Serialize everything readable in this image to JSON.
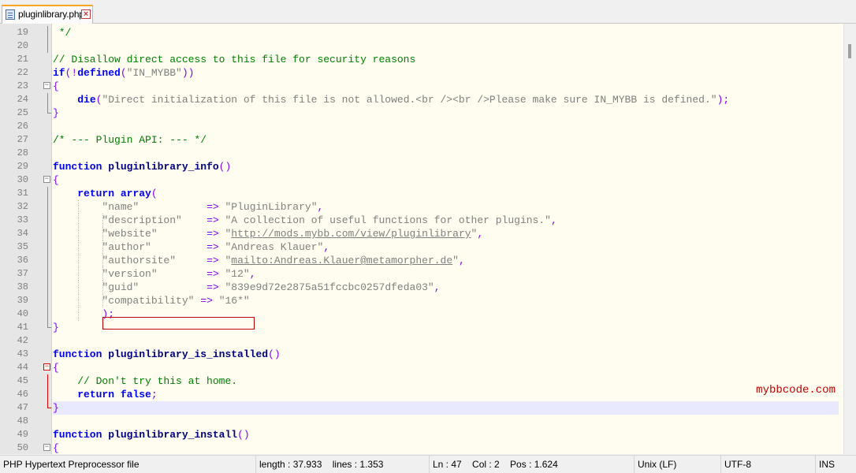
{
  "tab": {
    "filename": "pluginlibrary.php",
    "icon": "php-file-icon",
    "close_icon": "close-icon"
  },
  "lines": [
    {
      "n": "19",
      "fold": "vline",
      "tokens": [
        [
          "cmt",
          " */"
        ]
      ]
    },
    {
      "n": "20",
      "fold": "vline",
      "tokens": []
    },
    {
      "n": "21",
      "fold": "",
      "tokens": [
        [
          "cmt",
          "// Disallow direct access to this file for security reasons"
        ]
      ]
    },
    {
      "n": "22",
      "fold": "",
      "tokens": [
        [
          "kw",
          "if"
        ],
        [
          "op",
          "(!"
        ],
        [
          "kw",
          "defined"
        ],
        [
          "op",
          "("
        ],
        [
          "str",
          "\"IN_MYBB\""
        ],
        [
          "op",
          "))"
        ]
      ]
    },
    {
      "n": "23",
      "fold": "box",
      "tokens": [
        [
          "op",
          "{"
        ]
      ]
    },
    {
      "n": "24",
      "fold": "vline",
      "tokens": [
        [
          "plain",
          "    "
        ],
        [
          "kw",
          "die"
        ],
        [
          "op",
          "("
        ],
        [
          "str",
          "\"Direct initialization of this file is not allowed.<br /><br />Please make sure IN_MYBB is defined.\""
        ],
        [
          "op",
          ");"
        ]
      ]
    },
    {
      "n": "25",
      "fold": "end",
      "tokens": [
        [
          "op",
          "}"
        ]
      ]
    },
    {
      "n": "26",
      "fold": "",
      "tokens": []
    },
    {
      "n": "27",
      "fold": "",
      "tokens": [
        [
          "cmt",
          "/* --- Plugin API: --- */"
        ]
      ]
    },
    {
      "n": "28",
      "fold": "",
      "tokens": []
    },
    {
      "n": "29",
      "fold": "",
      "tokens": [
        [
          "kw",
          "function"
        ],
        [
          "plain",
          " "
        ],
        [
          "fn",
          "pluginlibrary_info"
        ],
        [
          "op",
          "()"
        ]
      ]
    },
    {
      "n": "30",
      "fold": "box",
      "tokens": [
        [
          "op",
          "{"
        ]
      ]
    },
    {
      "n": "31",
      "fold": "vline",
      "tokens": [
        [
          "plain",
          "    "
        ],
        [
          "kw",
          "return"
        ],
        [
          "plain",
          " "
        ],
        [
          "kw",
          "array"
        ],
        [
          "op",
          "("
        ]
      ]
    },
    {
      "n": "32",
      "fold": "vline",
      "tokens": [
        [
          "plain",
          "        "
        ],
        [
          "str",
          "\"name\""
        ],
        [
          "plain",
          "           "
        ],
        [
          "op",
          "=>"
        ],
        [
          "plain",
          " "
        ],
        [
          "str",
          "\"PluginLibrary\""
        ],
        [
          "op",
          ","
        ]
      ]
    },
    {
      "n": "33",
      "fold": "vline",
      "tokens": [
        [
          "plain",
          "        "
        ],
        [
          "str",
          "\"description\""
        ],
        [
          "plain",
          "    "
        ],
        [
          "op",
          "=>"
        ],
        [
          "plain",
          " "
        ],
        [
          "str",
          "\"A collection of useful functions for other plugins.\""
        ],
        [
          "op",
          ","
        ]
      ]
    },
    {
      "n": "34",
      "fold": "vline",
      "tokens": [
        [
          "plain",
          "        "
        ],
        [
          "str",
          "\"website\""
        ],
        [
          "plain",
          "        "
        ],
        [
          "op",
          "=>"
        ],
        [
          "plain",
          " "
        ],
        [
          "str",
          "\""
        ],
        [
          "url",
          "http://mods.mybb.com/view/pluginlibrary"
        ],
        [
          "str",
          "\""
        ],
        [
          "op",
          ","
        ]
      ]
    },
    {
      "n": "35",
      "fold": "vline",
      "tokens": [
        [
          "plain",
          "        "
        ],
        [
          "str",
          "\"author\""
        ],
        [
          "plain",
          "         "
        ],
        [
          "op",
          "=>"
        ],
        [
          "plain",
          " "
        ],
        [
          "str",
          "\"Andreas Klauer\""
        ],
        [
          "op",
          ","
        ]
      ]
    },
    {
      "n": "36",
      "fold": "vline",
      "tokens": [
        [
          "plain",
          "        "
        ],
        [
          "str",
          "\"authorsite\""
        ],
        [
          "plain",
          "     "
        ],
        [
          "op",
          "=>"
        ],
        [
          "plain",
          " "
        ],
        [
          "str",
          "\""
        ],
        [
          "url",
          "mailto:Andreas.Klauer@metamorpher.de"
        ],
        [
          "str",
          "\""
        ],
        [
          "op",
          ","
        ]
      ]
    },
    {
      "n": "37",
      "fold": "vline",
      "tokens": [
        [
          "plain",
          "        "
        ],
        [
          "str",
          "\"version\""
        ],
        [
          "plain",
          "        "
        ],
        [
          "op",
          "=>"
        ],
        [
          "plain",
          " "
        ],
        [
          "str",
          "\"12\""
        ],
        [
          "op",
          ","
        ]
      ]
    },
    {
      "n": "38",
      "fold": "vline",
      "tokens": [
        [
          "plain",
          "        "
        ],
        [
          "str",
          "\"guid\""
        ],
        [
          "plain",
          "           "
        ],
        [
          "op",
          "=>"
        ],
        [
          "plain",
          " "
        ],
        [
          "str",
          "\"839e9d72e2875a51fccbc0257dfeda03\""
        ],
        [
          "op",
          ","
        ]
      ]
    },
    {
      "n": "39",
      "fold": "vline",
      "tokens": [
        [
          "plain",
          "        "
        ],
        [
          "str",
          "\"compatibility\""
        ],
        [
          "plain",
          " "
        ],
        [
          "op",
          "=>"
        ],
        [
          "plain",
          " "
        ],
        [
          "str",
          "\"16*\""
        ]
      ]
    },
    {
      "n": "40",
      "fold": "vline",
      "tokens": [
        [
          "plain",
          "        "
        ],
        [
          "op",
          ");"
        ]
      ]
    },
    {
      "n": "41",
      "fold": "end",
      "tokens": [
        [
          "op",
          "}"
        ]
      ]
    },
    {
      "n": "42",
      "fold": "",
      "tokens": []
    },
    {
      "n": "43",
      "fold": "",
      "tokens": [
        [
          "kw",
          "function"
        ],
        [
          "plain",
          " "
        ],
        [
          "fn",
          "pluginlibrary_is_installed"
        ],
        [
          "op",
          "()"
        ]
      ]
    },
    {
      "n": "44",
      "fold": "box red",
      "tokens": [
        [
          "op",
          "{"
        ]
      ]
    },
    {
      "n": "45",
      "fold": "vline red",
      "tokens": [
        [
          "plain",
          "    "
        ],
        [
          "cmt",
          "// Don't try this at home."
        ]
      ]
    },
    {
      "n": "46",
      "fold": "vline red",
      "tokens": [
        [
          "plain",
          "    "
        ],
        [
          "kw",
          "return"
        ],
        [
          "plain",
          " "
        ],
        [
          "kw",
          "false"
        ],
        [
          "op",
          ";"
        ]
      ]
    },
    {
      "n": "47",
      "fold": "end red",
      "current": true,
      "tokens": [
        [
          "op",
          "}"
        ]
      ]
    },
    {
      "n": "48",
      "fold": "",
      "tokens": []
    },
    {
      "n": "49",
      "fold": "",
      "tokens": [
        [
          "kw",
          "function"
        ],
        [
          "plain",
          " "
        ],
        [
          "fn",
          "pluginlibrary_install"
        ],
        [
          "op",
          "()"
        ]
      ]
    },
    {
      "n": "50",
      "fold": "box",
      "tokens": [
        [
          "op",
          "{"
        ]
      ]
    }
  ],
  "watermark": "mybbcode.com",
  "status": {
    "filetype": "PHP Hypertext Preprocessor file",
    "length": "length : 37.933    lines : 1.353",
    "position": "Ln : 47    Col : 2    Pos : 1.624",
    "eol": "Unix (LF)",
    "encoding": "UTF-8",
    "mode": "INS"
  },
  "colors": {
    "keyword": "#0000ff",
    "comment": "#008000",
    "string": "#808080",
    "operator": "#8000ff",
    "highlight_box": "#c00000",
    "current_line": "#e8e8ff"
  }
}
